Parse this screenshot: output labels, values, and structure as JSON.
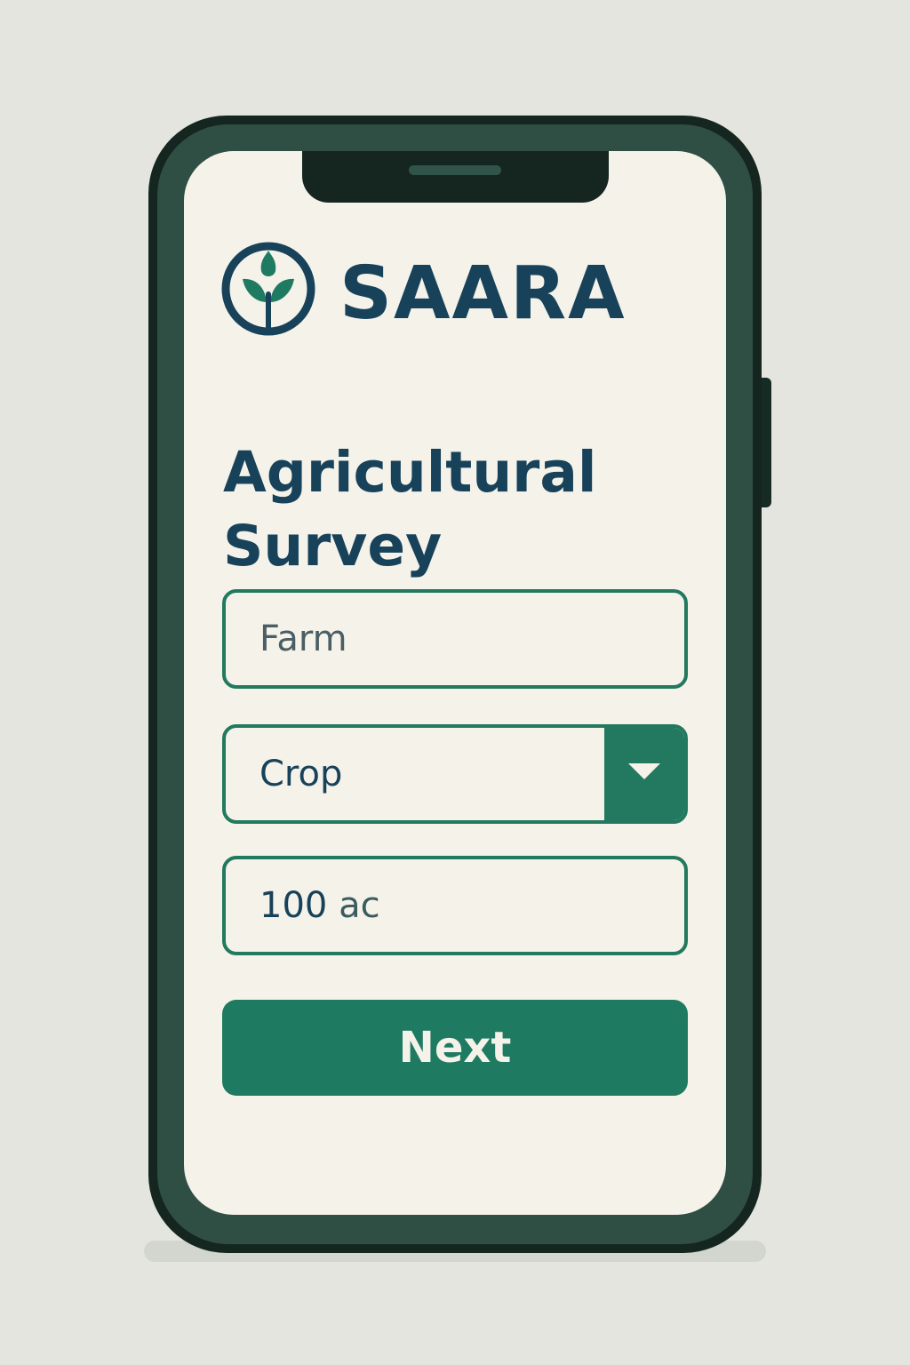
{
  "app": {
    "brand_name": "SAARA",
    "logo_icon": "sprout-icon"
  },
  "page": {
    "title": "Agricultural Survey"
  },
  "form": {
    "farm_field": {
      "placeholder": "Farm",
      "value": ""
    },
    "crop_select": {
      "selected": "Crop",
      "arrow_icon": "chevron-down-icon"
    },
    "acreage_field": {
      "number": "100",
      "unit": "ac"
    },
    "next_button_label": "Next"
  },
  "colors": {
    "background": "#e4e5df",
    "phone_frame": "#14261f",
    "screen": "#f5f2ea",
    "primary_text": "#17425a",
    "accent_green": "#22795f",
    "button_green": "#1f7a62"
  }
}
